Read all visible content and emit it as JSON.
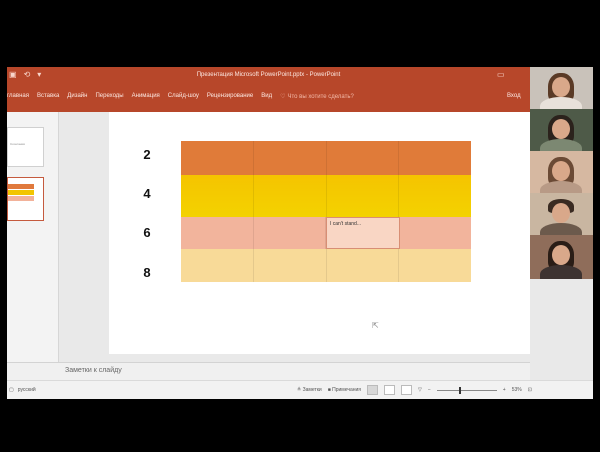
{
  "window": {
    "title": "Презентация Microsoft PowerPoint.pptx - PowerPoint",
    "signin": "Вход"
  },
  "ribbon": {
    "tabs": [
      "главная",
      "Вставка",
      "Дизайн",
      "Переходы",
      "Анимация",
      "Слайд-шоу",
      "Рецензирование",
      "Вид"
    ],
    "tell_me": "Что вы хотите сделать?"
  },
  "slide": {
    "row_labels": [
      "2",
      "4",
      "6",
      "8"
    ],
    "note_text": "I can't stand..."
  },
  "thumbnail": {
    "label": "Сочетания"
  },
  "notes": {
    "placeholder": "Заметки к слайду"
  },
  "status": {
    "language": "русский",
    "notes_btn": "Заметки",
    "comments_btn": "Примечания",
    "zoom": "53%"
  },
  "colors": {
    "ppt_red": "#b7472a",
    "row1": "#e07b39",
    "row2": "#f5c400",
    "row3": "#f2b49c",
    "row4": "#f8da98"
  }
}
